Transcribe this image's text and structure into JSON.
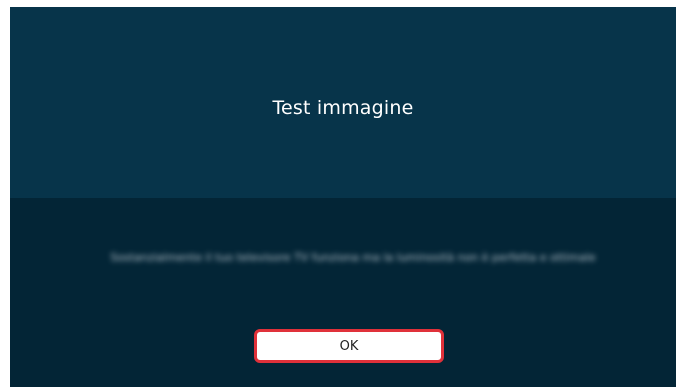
{
  "dialog": {
    "title": "Test immagine",
    "message": "Sostanzialmente il tuo televisore TV funziona ma la luminosità non è perfetta e ottimale",
    "ok_label": "OK"
  },
  "colors": {
    "top_panel": "#07344a",
    "bottom_panel": "#032536",
    "focus_border": "#e0313a"
  }
}
